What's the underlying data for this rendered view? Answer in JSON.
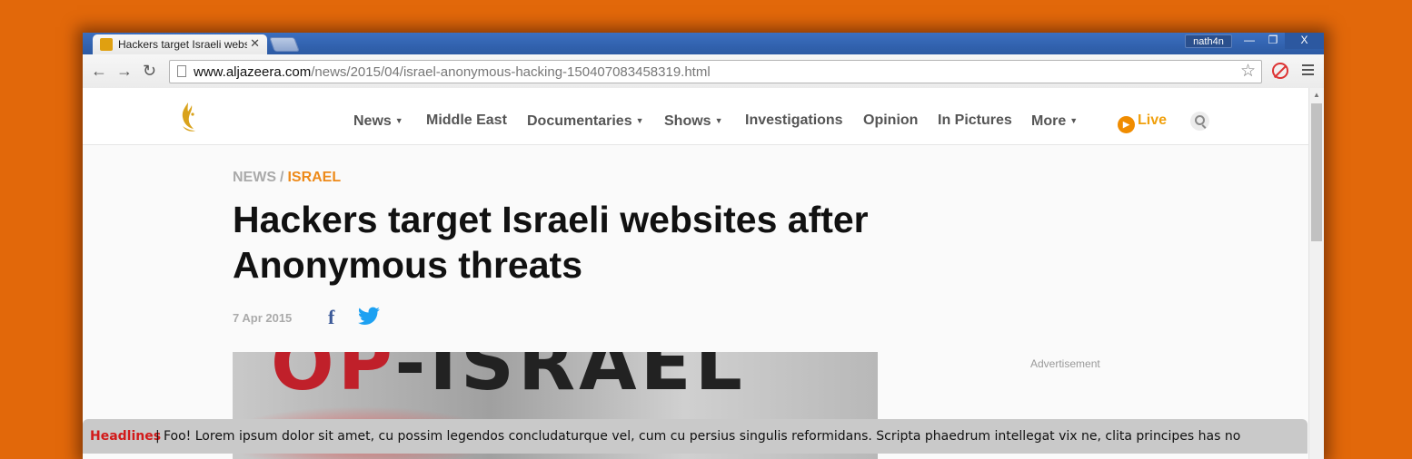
{
  "browser": {
    "tab": {
      "title": "Hackers target Israeli webs",
      "close": "✕"
    },
    "user": "nath4n",
    "window_controls": {
      "minimize": "—",
      "maximize": "❐",
      "close": "X"
    },
    "address": {
      "domain": "www.aljazeera.com",
      "path": "/news/2015/04/israel-anonymous-hacking-150407083458319.html"
    },
    "nav": {
      "back": "←",
      "forward": "→",
      "reload": "↻"
    },
    "icons": [
      "page-icon",
      "bookmark-star-icon",
      "extension-icon",
      "menu-icon"
    ]
  },
  "site": {
    "nav": [
      {
        "label": "News",
        "dropdown": true
      },
      {
        "label": "Middle East",
        "dropdown": false
      },
      {
        "label": "Documentaries",
        "dropdown": true
      },
      {
        "label": "Shows",
        "dropdown": true
      },
      {
        "label": "Investigations",
        "dropdown": false
      },
      {
        "label": "Opinion",
        "dropdown": false
      },
      {
        "label": "In Pictures",
        "dropdown": false
      },
      {
        "label": "More",
        "dropdown": true
      }
    ],
    "caret": "▼",
    "live": "Live",
    "live_icon": "▶"
  },
  "article": {
    "breadcrumb": {
      "section": "NEWS",
      "sep": "/",
      "category": "ISRAEL"
    },
    "headline": "Hackers target Israeli websites after Anonymous threats",
    "date": "7 Apr 2015",
    "share": {
      "facebook": "f"
    },
    "hero": {
      "prefix": "OP",
      "rest": "-ISRAEL"
    }
  },
  "sidebar": {
    "ad_label": "Advertisement"
  },
  "ticker": {
    "label": "Headlines",
    "sep": "|",
    "text": "Foo! Lorem ipsum dolor sit amet, cu possim legendos concludaturque vel, cum cu persius singulis reformidans. Scripta phaedrum intellegat vix ne, clita principes has no"
  },
  "colors": {
    "background": "#e2680a",
    "titlebar": "#2e5da8",
    "accent": "#ed8a1a",
    "headline_red": "#d21a1a",
    "facebook": "#3b5998",
    "twitter": "#1da1f2"
  }
}
